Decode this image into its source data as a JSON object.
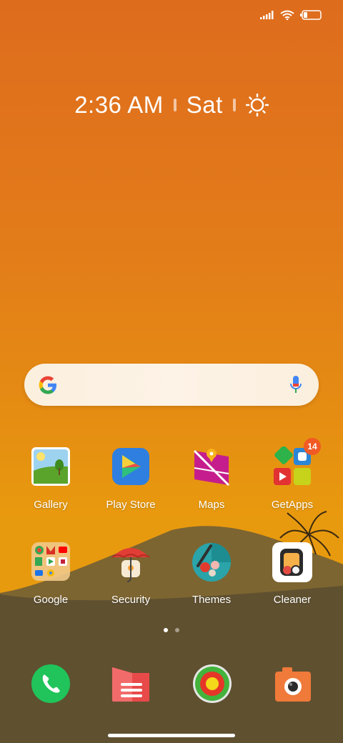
{
  "status_bar": {
    "icons": [
      "signal-icon",
      "wifi-icon",
      "battery-icon"
    ]
  },
  "clock": {
    "time": "2:36 AM",
    "day": "Sat",
    "weather_icon": "sun-icon"
  },
  "search": {
    "logo": "google-g-icon",
    "mic": "microphone-icon"
  },
  "apps_row1": [
    {
      "label": "Gallery",
      "icon": "gallery-icon"
    },
    {
      "label": "Play Store",
      "icon": "play-store-icon"
    },
    {
      "label": "Maps",
      "icon": "maps-icon"
    },
    {
      "label": "GetApps",
      "icon": "getapps-icon",
      "badge": "14"
    }
  ],
  "apps_row2": [
    {
      "label": "Google",
      "icon": "google-folder-icon"
    },
    {
      "label": "Security",
      "icon": "security-icon"
    },
    {
      "label": "Themes",
      "icon": "themes-icon"
    },
    {
      "label": "Cleaner",
      "icon": "cleaner-icon"
    }
  ],
  "page_indicator": {
    "pages": 2,
    "current": 1
  },
  "dock": [
    "phone-icon",
    "messages-icon",
    "browser-icon",
    "camera-icon"
  ],
  "colors": {
    "accent_badge": "#f15a24",
    "wallpaper_top": "#de6c1d",
    "wallpaper_mid": "#e89a0e",
    "ground": "#5f5030"
  }
}
